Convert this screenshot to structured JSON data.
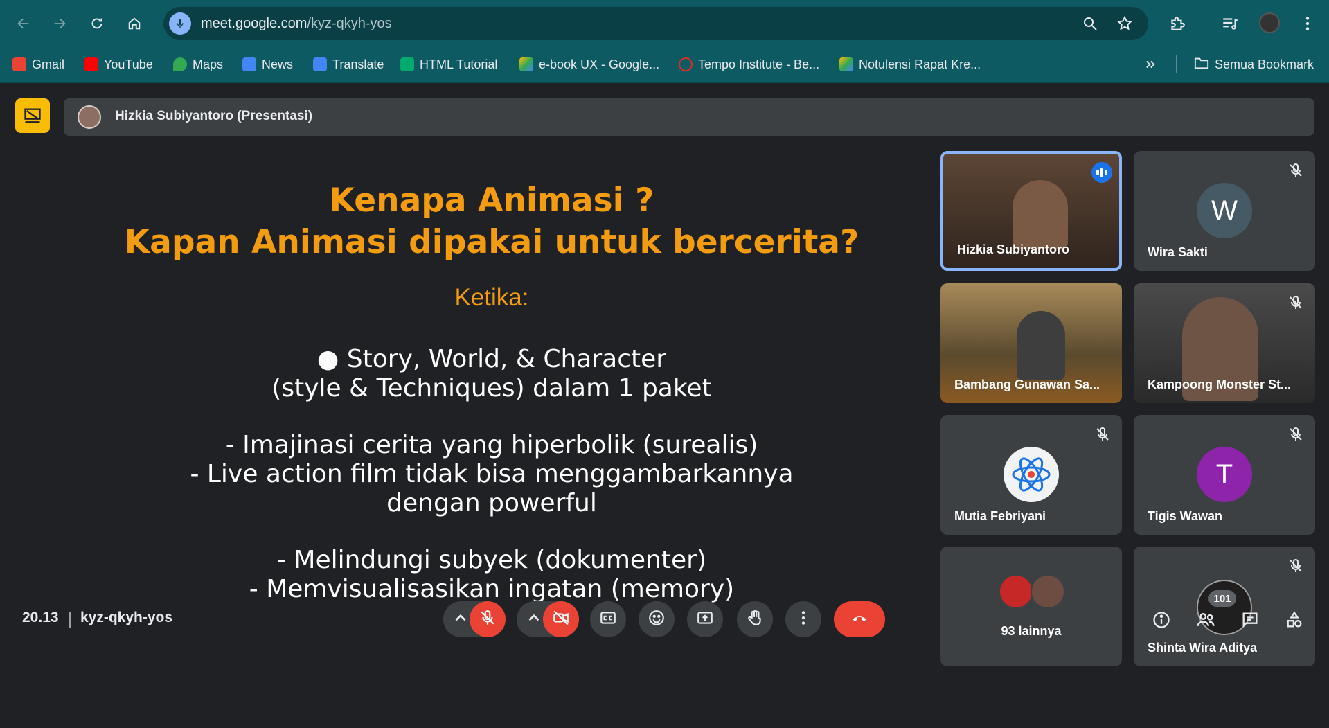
{
  "browser": {
    "url_host": "meet.google.com",
    "url_path": "/kyz-qkyh-yos",
    "bookmarks": [
      {
        "label": "Gmail",
        "color": "#ea4335"
      },
      {
        "label": "YouTube",
        "color": "#ff0000"
      },
      {
        "label": "Maps",
        "color": "#34a853"
      },
      {
        "label": "News",
        "color": "#4285f4"
      },
      {
        "label": "Translate",
        "color": "#4285f4"
      },
      {
        "label": "HTML Tutorial",
        "color": "#04aa6d"
      },
      {
        "label": "e-book UX - Google...",
        "color": "#fbbc04"
      },
      {
        "label": "Tempo Institute - Be...",
        "color": "#d93025"
      },
      {
        "label": "Notulensi Rapat Kre...",
        "color": "#fbbc04"
      }
    ],
    "all_bookmarks": "Semua Bookmark"
  },
  "meet": {
    "presenter_label": "Hizkia Subiyantoro (Presentasi)",
    "slide": {
      "title_line1": "Kenapa Animasi ?",
      "title_line2": "Kapan Animasi dipakai untuk bercerita?",
      "subtitle": "Ketika:",
      "lines": [
        "●   Story, World, & Character",
        "(style & Techniques) dalam 1 paket",
        "-   Imajinasi cerita yang hiperbolik (surealis)",
        "-   Live action film tidak bisa menggambarkannya",
        "dengan powerful",
        "-   Melindungi subyek (dokumenter)",
        "-   Memvisualisasikan ingatan (memory)"
      ]
    },
    "participants": [
      {
        "name": "Hizkia Subiyantoro"
      },
      {
        "name": "Wira Sakti",
        "initial": "W"
      },
      {
        "name": "Bambang Gunawan Sa..."
      },
      {
        "name": "Kampoong Monster St..."
      },
      {
        "name": "Mutia Febriyani"
      },
      {
        "name": "Tigis Wawan",
        "initial": "T"
      },
      {
        "name": "93 lainnya"
      },
      {
        "name": "Shinta Wira Aditya"
      }
    ],
    "time": "20.13",
    "meeting_code": "kyz-qkyh-yos",
    "participant_count": "101"
  }
}
